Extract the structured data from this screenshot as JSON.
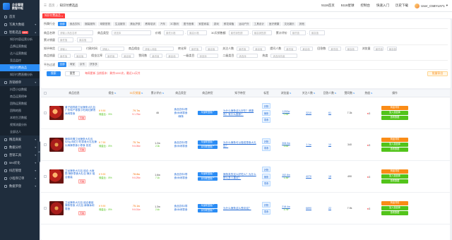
{
  "brand": {
    "line1": "企业管理",
    "line2": "数智中枢"
  },
  "sidebar": {
    "items": [
      {
        "label": "首页",
        "icon": "home-icon"
      },
      {
        "label": "写真大数据",
        "icon": "photo-icon",
        "arrow": "chevron-down-icon"
      },
      {
        "label": "智能选品",
        "icon": "select-icon",
        "hot": "HOT"
      },
      {
        "label": "热销榜单",
        "icon": "fire-icon"
      },
      {
        "label": "精选商家",
        "icon": "shop-icon"
      },
      {
        "label": "数据分析",
        "icon": "chart-icon"
      },
      {
        "label": "营销工具",
        "icon": "tool-icon"
      },
      {
        "label": "seo优化",
        "icon": "seo-icon"
      },
      {
        "label": "抖店管理",
        "icon": "store-icon"
      },
      {
        "label": "小程序订单",
        "icon": "order-icon"
      },
      {
        "label": "数据罗盘",
        "icon": "compass-icon"
      }
    ],
    "subs": [
      "知识内容运营分析",
      "品牌运营数据",
      "达人运营数据",
      "竞品监控",
      "知识付费选品",
      "知识付费直播分析",
      "抖音小店数据",
      "商品运营榜单",
      "团购运营数据",
      "团购地图",
      "本地生活数据",
      "视频流量分析",
      "全部达人"
    ]
  },
  "header": {
    "breadcrumb": [
      "首页",
      "知识付费选品"
    ],
    "actions": [
      "5118首页",
      "5118星球",
      "控制台",
      "快速入门",
      "历史下载"
    ],
    "user": "User_C5BYLN*1"
  },
  "tabs": [
    "知识付费选品"
  ],
  "filters": {
    "category_label": "所属行业",
    "categories": [
      "全部",
      "食品饮料",
      "服装服饰",
      "母婴宠物",
      "生活服务",
      "美妆护肤",
      "教育培训",
      "汽车",
      "3C数码",
      "图书音像",
      "家居家装",
      "游戏",
      "鲜花绿植",
      "运动户外",
      "工具设计",
      "医疗健康",
      "文化娱乐",
      "其他"
    ],
    "rows": [
      [
        {
          "label": "商品名称",
          "placeholder": "请输入商品名称"
        },
        {
          "label": "商品类型",
          "placeholder": "请选择"
        },
        {
          "label": "价格",
          "from": "最低价格",
          "to": "最高价格"
        },
        {
          "label": "30天销售额",
          "from": "最低销售额",
          "to": "最高销售额"
        },
        {
          "label": "累计评价",
          "from": "最低值",
          "to": "最高值"
        }
      ],
      [
        {
          "label": "累计销量",
          "from": "最低值",
          "to": "最高值"
        }
      ],
      [
        {
          "label": "知乎带货",
          "placeholder": "请输入"
        },
        {
          "label": "付款时间",
          "placeholder": "请输入"
        },
        {
          "label": "商品佣金",
          "placeholder": "请输入佣金"
        },
        {
          "label": "转化率",
          "from": "最低值",
          "to": "最高值"
        },
        {
          "label": "关注人数",
          "from": "最低值",
          "to": "最高值"
        },
        {
          "label": "提问人数",
          "from": "最低值",
          "to": "最高值"
        },
        {
          "label": "回答数",
          "from": "最低值",
          "to": "最高值"
        },
        {
          "label": "浏览量",
          "from": "最低值",
          "to": "最高值"
        }
      ],
      [
        {
          "label": "商品销量",
          "from": "最低值",
          "to": "最高值"
        },
        {
          "label": "佣金比率",
          "from": "最低值",
          "to": "最高值"
        },
        {
          "label": "赞同数",
          "from": "最低值",
          "to": "最高值"
        },
        {
          "label": "一级类目",
          "placeholder": "请选择"
        },
        {
          "label": "二级类目",
          "placeholder": "请选择"
        },
        {
          "label": "热度",
          "placeholder": "请选择热度"
        }
      ]
    ],
    "platform_label": "平台过滤",
    "platforms": [
      "全部",
      "淘宝",
      "京东",
      "拼多多"
    ],
    "search_btn": "搜索",
    "reset_btn": "重置",
    "notice": "每周更新 当前版本：剩余1000次，最近14天共",
    "export_btn": "批量导出"
  },
  "table": {
    "headers": [
      "",
      "商品信息",
      "佣金",
      "30天销量",
      "累计评价",
      "商品类型",
      "商品带货",
      "知乎带货",
      "标签",
      "浏览量",
      "关注人数",
      "回答人数",
      "赞同数",
      "热度",
      "操作"
    ],
    "rows": [
      {
        "title": "黄子韬同款卫龙辣条大礼包 广东特产零食小吃网红解馋休闲零食",
        "tag": "天猫",
        "price": "¥ 9.90",
        "rate": "佣金比：5%",
        "comm": "79.7w",
        "comm_sub": "¥ 1.75w",
        "sales": "46",
        "sales_sub": "",
        "review": "15",
        "cats": [
          "食品饮料/零",
          "食/休闲零食",
          "/辣条"
        ],
        "btns": [
          "淘宝联盟推广"
        ],
        "zhihu": "为什么辣条这么好吃？健康吗？有什么推荐？",
        "tags": [
          "好物",
          "辣条",
          "零食"
        ],
        "views": "1292w",
        "views_sub": "0.9w",
        "follow": "3210",
        "answers": "61",
        "agree": "7.3k",
        "heat": "3",
        "ops": [
          "商品详情",
          "加入选品库",
          "查看数据"
        ]
      },
      {
        "title": "辣味风情卫龙辣条大礼包 520g 网红小吃零食大礼包辣片麻辣零食小零食 批发",
        "tag": "天猫",
        "price": "¥ 7.90",
        "rate": "佣金比：8%",
        "comm": "75.7w",
        "comm_sub": "¥ 6.05w",
        "sales": "1.2w",
        "sales_sub": "2.3k",
        "review": "10",
        "cats": [
          "食品饮料/零",
          "食/休闲零食"
        ],
        "btns": [
          "淘宝联盟推广",
          "京东联盟推广"
        ],
        "zhihu": "为什么辣条可以做成零食大礼包？",
        "tags": [
          "好物",
          "零食"
        ],
        "views": "308.5w",
        "views_sub": "5.6w",
        "follow": "1.1w",
        "answers": "10",
        "agree": "340",
        "heat": "3",
        "ops": [
          "商品详情",
          "加入选品库",
          "查看数据"
        ]
      },
      {
        "title": "卫龙辣条大礼包 组合 大面筋 辣条零食大礼包 辣片 组合套装",
        "tag": "天猫",
        "price": "¥ 9.90",
        "rate": "佣金比：8%",
        "comm": "78.8w",
        "comm_sub": "¥ 6.29w",
        "sales": "1.6w",
        "sales_sub": "7.1k",
        "review": "8",
        "cats": [
          "食品饮料/零",
          "食/休闲零食"
        ],
        "btns": [
          "淘宝联盟推广",
          "京东联盟推广"
        ],
        "zhihu": "辣条真的这么好吃么？为什么那么多人喜欢？",
        "tags": [
          "好物",
          "辣条",
          "零食"
        ],
        "views": "152.8w",
        "views_sub": "1.3w",
        "follow": "4270",
        "answers": "18",
        "agree": "490",
        "heat": "3",
        "ops": [
          "商品详情",
          "加入选品库",
          "查看数据"
        ]
      },
      {
        "title": "卫龙辣条大礼包 组合套装 辣条零食 大礼包 麻辣休闲零食",
        "tag": "天猫",
        "price": "¥ 9.90",
        "rate": "佣金比：8%",
        "comm": "75.1w",
        "comm_sub": "¥ 6.01w",
        "sales": "1.3w",
        "sales_sub": "2.4k",
        "review": "9",
        "cats": [
          "食品饮料/零",
          "食/休闲零食"
        ],
        "btns": [
          "淘宝联盟推广",
          "京东联盟推广"
        ],
        "zhihu": "为什么辣条这么受欢迎？",
        "tags": [
          "好物",
          "零食"
        ],
        "views": "218.4w",
        "views_sub": "3.7w",
        "follow": "6890",
        "answers": "22",
        "agree": "7.9k",
        "heat": "3",
        "ops": [
          "商品详情",
          "加入选品库",
          "查看数据"
        ]
      }
    ]
  }
}
